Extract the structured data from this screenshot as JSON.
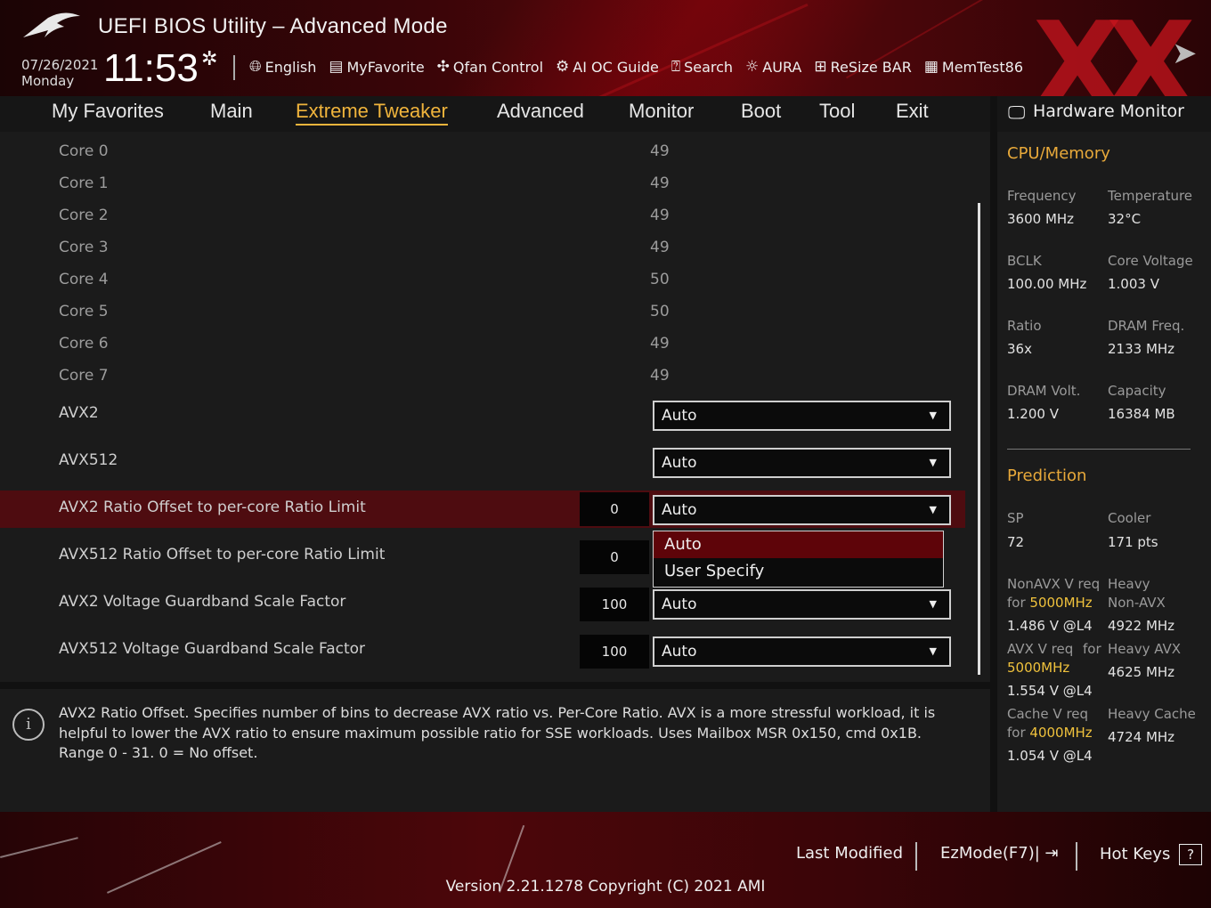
{
  "header": {
    "title": "UEFI BIOS Utility – Advanced Mode",
    "date": "07/26/2021",
    "day": "Monday",
    "time": "11:53",
    "toolbar": [
      {
        "label": "English",
        "icon": "globe-icon"
      },
      {
        "label": "MyFavorite",
        "icon": "favorite-list-icon"
      },
      {
        "label": "Qfan Control",
        "icon": "fan-icon"
      },
      {
        "label": "AI OC Guide",
        "icon": "chip-icon"
      },
      {
        "label": "Search",
        "icon": "help-search-icon"
      },
      {
        "label": "AURA",
        "icon": "light-icon"
      },
      {
        "label": "ReSize BAR",
        "icon": "resize-bar-icon"
      },
      {
        "label": "MemTest86",
        "icon": "memory-icon"
      }
    ]
  },
  "nav": {
    "tabs": [
      "My Favorites",
      "Main",
      "Extreme Tweaker",
      "Advanced",
      "Monitor",
      "Boot",
      "Tool",
      "Exit"
    ],
    "active": "Extreme Tweaker"
  },
  "settings": {
    "cores": [
      {
        "label": "Core 0",
        "value": "49"
      },
      {
        "label": "Core 1",
        "value": "49"
      },
      {
        "label": "Core 2",
        "value": "49"
      },
      {
        "label": "Core 3",
        "value": "49"
      },
      {
        "label": "Core 4",
        "value": "50"
      },
      {
        "label": "Core 5",
        "value": "50"
      },
      {
        "label": "Core 6",
        "value": "49"
      },
      {
        "label": "Core 7",
        "value": "49"
      }
    ],
    "avx2": {
      "label": "AVX2",
      "value": "Auto"
    },
    "avx512": {
      "label": "AVX512",
      "value": "Auto"
    },
    "avx2_offset": {
      "label": "AVX2 Ratio Offset to per-core Ratio Limit",
      "number": "0",
      "value": "Auto"
    },
    "avx512_offset": {
      "label": "AVX512 Ratio Offset to per-core Ratio Limit",
      "number": "0"
    },
    "avx2_guardband": {
      "label": "AVX2 Voltage Guardband Scale Factor",
      "number": "100",
      "value": "Auto"
    },
    "avx512_guardband": {
      "label": "AVX512 Voltage Guardband Scale Factor",
      "number": "100",
      "value": "Auto"
    },
    "dropdown_options": [
      "Auto",
      "User Specify"
    ],
    "dropdown_selected": "Auto"
  },
  "help_text": "AVX2 Ratio Offset. Specifies number of bins to decrease AVX ratio vs. Per-Core Ratio. AVX is a more stressful workload, it is helpful to lower the AVX ratio to ensure maximum possible ratio for SSE workloads. Uses Mailbox MSR 0x150, cmd 0x1B. Range 0 - 31. 0 = No offset.",
  "hardware_monitor": {
    "title": "Hardware Monitor",
    "cpu_memory": {
      "title": "CPU/Memory",
      "items": [
        {
          "label": "Frequency",
          "value": "3600 MHz"
        },
        {
          "label": "Temperature",
          "value": "32°C"
        },
        {
          "label": "BCLK",
          "value": "100.00 MHz"
        },
        {
          "label": "Core Voltage",
          "value": "1.003 V"
        },
        {
          "label": "Ratio",
          "value": "36x"
        },
        {
          "label": "DRAM Freq.",
          "value": "2133 MHz"
        },
        {
          "label": "DRAM Volt.",
          "value": "1.200 V"
        },
        {
          "label": "Capacity",
          "value": "16384 MB"
        }
      ]
    },
    "prediction": {
      "title": "Prediction",
      "sp_label": "SP",
      "sp_value": "72",
      "cooler_label": "Cooler",
      "cooler_value": "171 pts",
      "nonavx_req_label": "NonAVX V req",
      "nonavx_for": "for",
      "nonavx_freq": "5000MHz",
      "nonavx_volt": "1.486 V @L4",
      "heavy_nonavx_label1": "Heavy",
      "heavy_nonavx_label2": "Non-AVX",
      "heavy_nonavx_value": "4922 MHz",
      "avx_req_label": "AVX V req",
      "avx_for": "for",
      "avx_freq": "5000MHz",
      "avx_volt": "1.554 V @L4",
      "heavy_avx_label": "Heavy AVX",
      "heavy_avx_value": "4625 MHz",
      "cache_req_label": "Cache V req",
      "cache_for": "for",
      "cache_freq": "4000MHz",
      "cache_volt": "1.054 V @L4",
      "heavy_cache_label": "Heavy Cache",
      "heavy_cache_value": "4724 MHz"
    }
  },
  "footer": {
    "last_modified": "Last Modified",
    "ezmode": "EzMode(F7)|",
    "hot_keys": "Hot Keys",
    "hot_keys_glyph": "?",
    "version": "Version 2.21.1278 Copyright (C) 2021 AMI"
  },
  "colors": {
    "accent": "#f0b43c",
    "highlight_row": "#4e0c10",
    "brand_red": "#c8141e"
  }
}
